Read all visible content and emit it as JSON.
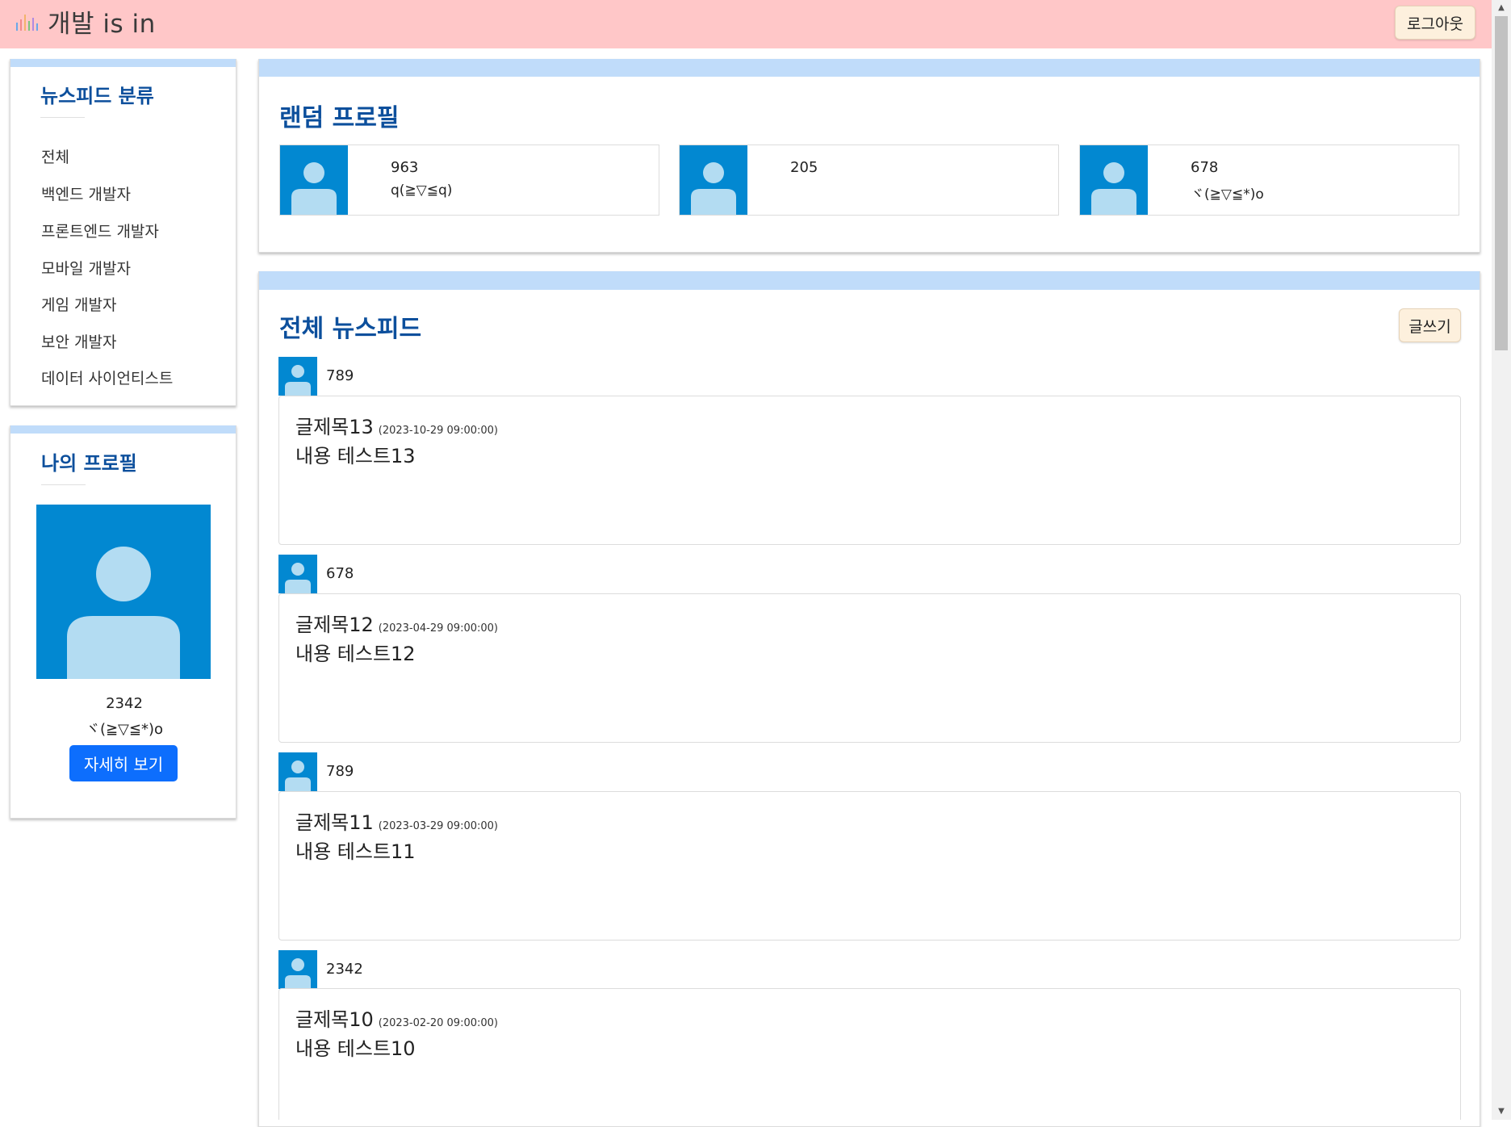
{
  "header": {
    "app_title": "개발 is in",
    "logout_label": "로그아웃",
    "logo_colors": [
      "#6aa7e8",
      "#f08a8a",
      "#f2b36b",
      "#7cc57c",
      "#b08ae0"
    ]
  },
  "sidebar": {
    "categories_title": "뉴스피드 분류",
    "categories": [
      {
        "label": "전체"
      },
      {
        "label": "백엔드 개발자"
      },
      {
        "label": "프론트엔드 개발자"
      },
      {
        "label": "모바일 개발자"
      },
      {
        "label": "게임 개발자"
      },
      {
        "label": "보안 개발자"
      },
      {
        "label": "데이터 사이언티스트"
      }
    ],
    "my_profile": {
      "title": "나의 프로필",
      "name": "2342",
      "bio": "ヾ(≧▽≦*)o",
      "detail_button": "자세히 보기"
    }
  },
  "random_profiles": {
    "title": "랜덤 프로필",
    "items": [
      {
        "name": "963",
        "bio": "q(≧▽≦q)"
      },
      {
        "name": "205",
        "bio": ""
      },
      {
        "name": "678",
        "bio": "ヾ(≧▽≦*)o"
      }
    ]
  },
  "feed": {
    "title": "전체 뉴스피드",
    "write_label": "글쓰기",
    "posts": [
      {
        "author": "789",
        "title": "글제목13",
        "date": "(2023-10-29 09:00:00)",
        "content": "내용 테스트13"
      },
      {
        "author": "678",
        "title": "글제목12",
        "date": "(2023-04-29 09:00:00)",
        "content": "내용 테스트12"
      },
      {
        "author": "789",
        "title": "글제목11",
        "date": "(2023-03-29 09:00:00)",
        "content": "내용 테스트11"
      },
      {
        "author": "2342",
        "title": "글제목10",
        "date": "(2023-02-20 09:00:00)",
        "content": "내용 테스트10"
      }
    ]
  },
  "colors": {
    "header_bg": "#ffc7c8",
    "card_accent": "#c0dcfa",
    "title_blue": "#0c4f9c",
    "avatar_bg": "#0288d1",
    "avatar_fg": "#b3dcf2",
    "primary_button": "#0d6efd",
    "soft_button": "#fdf0dd"
  },
  "icons": {
    "logo": "bar-chart-icon",
    "avatar": "user-silhouette-icon"
  }
}
